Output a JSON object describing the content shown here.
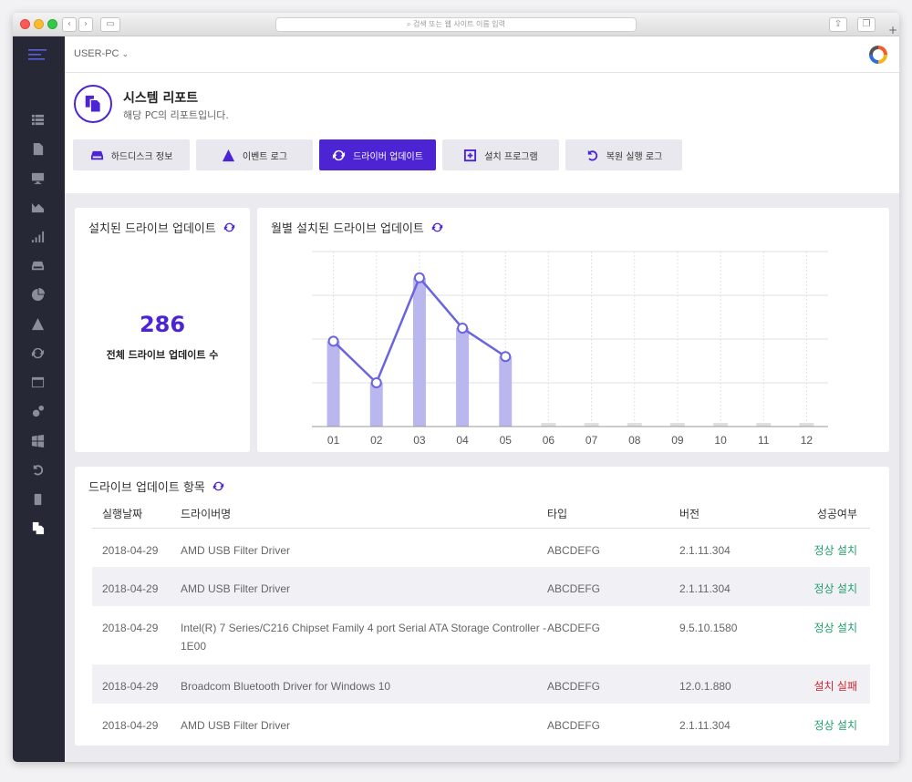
{
  "browser": {
    "address_placeholder": "검색 또는 웹 사이트 이름 입력"
  },
  "topbar": {
    "pc_name": "USER-PC"
  },
  "header": {
    "title": "시스템 리포트",
    "subtitle": "해당 PC의 리포트입니다."
  },
  "tabs": [
    {
      "label": "하드디스크 정보",
      "icon": "hard-drive-icon"
    },
    {
      "label": "이벤트 로그",
      "icon": "warning-icon"
    },
    {
      "label": "드라이버 업데이트",
      "icon": "refresh-icon",
      "active": true
    },
    {
      "label": "설치 프로그램",
      "icon": "plus-box-icon"
    },
    {
      "label": "복원 실행 로그",
      "icon": "undo-icon"
    }
  ],
  "summary": {
    "title": "설치된 드라이브 업데이트",
    "count": "286",
    "count_label": "전체 드라이브 업데이트 수"
  },
  "chart_data": {
    "type": "bar",
    "title": "월별 설치된 드라이브 업데이트",
    "categories": [
      "01",
      "02",
      "03",
      "04",
      "05",
      "06",
      "07",
      "08",
      "09",
      "10",
      "11",
      "12"
    ],
    "values": [
      39,
      20,
      68,
      45,
      32,
      0,
      0,
      0,
      0,
      0,
      0,
      0
    ],
    "overlay": "line over first five months",
    "ylim": [
      0,
      80
    ],
    "grid": true,
    "colors": {
      "bar": "#b9b7ee",
      "line": "#6a64e0",
      "empty_bar": "#e0e0e0"
    }
  },
  "table": {
    "title": "드라이브 업데이트 항목",
    "columns": [
      "실행날짜",
      "드라이버명",
      "타입",
      "버전",
      "성공여부"
    ],
    "rows": [
      {
        "date": "2018-04-29",
        "name": "AMD USB Filter Driver",
        "type": "ABCDEFG",
        "version": "2.1.11.304",
        "status": "정상 설치",
        "ok": true
      },
      {
        "date": "2018-04-29",
        "name": "AMD USB Filter Driver",
        "type": "ABCDEFG",
        "version": "2.1.11.304",
        "status": "정상 설치",
        "ok": true
      },
      {
        "date": "2018-04-29",
        "name": "Intel(R) 7 Series/C216 Chipset Family 4 port Serial ATA Storage Controller - 1E00",
        "type": "ABCDEFG",
        "version": "9.5.10.1580",
        "status": "정상 설치",
        "ok": true
      },
      {
        "date": "2018-04-29",
        "name": "Broadcom Bluetooth Driver for Windows 10",
        "type": "ABCDEFG",
        "version": "12.0.1.880",
        "status": "설치 실패",
        "ok": false
      },
      {
        "date": "2018-04-29",
        "name": "AMD USB Filter Driver",
        "type": "ABCDEFG",
        "version": "2.1.11.304",
        "status": "정상 설치",
        "ok": true
      }
    ]
  },
  "colors": {
    "accent": "#4c24d4",
    "sidebar": "#262836",
    "success": "#21a06b",
    "failure": "#d0252e"
  }
}
